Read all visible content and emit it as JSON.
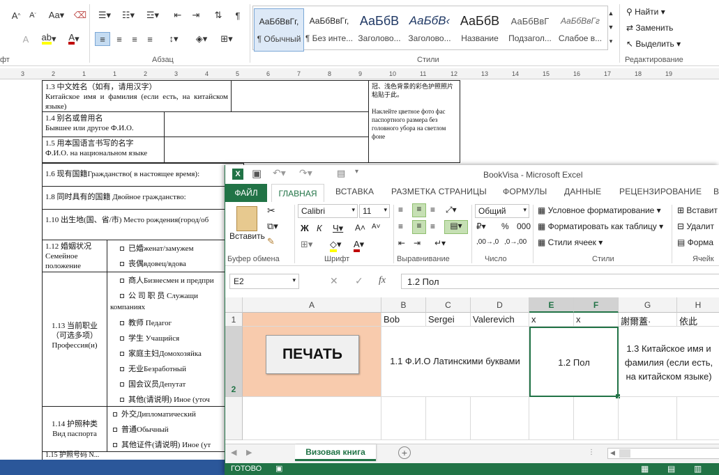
{
  "word": {
    "groups": {
      "font_partial": "фт",
      "paragraph": "Абзац",
      "styles": "Стили",
      "editing": "Редактирование"
    },
    "styles": [
      {
        "sample": "АаБбВвГг,",
        "name": "¶ Обычный"
      },
      {
        "sample": "АаБбВвГг,",
        "name": "¶ Без инте..."
      },
      {
        "sample": "АаБбВ",
        "name": "Заголово..."
      },
      {
        "sample": "АаБбВ‹",
        "name": "Заголово..."
      },
      {
        "sample": "АаБбВ",
        "name": "Название"
      },
      {
        "sample": "АаБбВвГ",
        "name": "Подзагол..."
      },
      {
        "sample": "АаБбВвГг",
        "name": "Слабое в..."
      }
    ],
    "editing": {
      "find": "Найти",
      "replace": "Заменить",
      "select": "Выделить"
    },
    "ruler": [
      "3",
      "2",
      "1",
      "1",
      "2",
      "3",
      "4",
      "5",
      "6",
      "7",
      "8",
      "9",
      "10",
      "11",
      "12",
      "13",
      "14",
      "15",
      "16",
      "17",
      "18",
      "19"
    ],
    "doc": {
      "r13": "1.3 中文姓名（如有，请用汉字）",
      "r13b": "Китайское имя и фамилия (если есть, на китайском языке)",
      "r14": "1.4 别名或曾用名",
      "r14b": "Бывшее или другое Ф.И.О.",
      "r15": "1.5 用本国语言书写的名字",
      "r15b": "Ф.И.О. на национальном языке",
      "photo_cn": "冠、浅色背景的彩色护照照片粘贴于此。",
      "photo_ru": "Наклейте цветное фото фас паспортного размера без головного убора на светлом фоне",
      "r16": "1.6 现有国籍Гражданство( в настоящее время):",
      "r18": "1.8 同时具有的国籍 Двойное гражданство:",
      "r110": "1.10 出生地(国、省/市) Место рождения(город/об",
      "r112": "1.12 婚姻状况 Семейное положение",
      "r112_opts": [
        "已婚женат/замужем",
        "丧偶вдовец/вдова"
      ],
      "r113": "1.13 当前职业（可选多项）Профессия(и)",
      "r113_opts": [
        "商人Бизнесмен и предпри",
        "公 司 职 员 Служащи",
        "компаниях",
        "教师 Педагог",
        "学生 Учащийся",
        "家庭主妇Домохозяйка",
        "无业Безработный",
        "国会议员Депутат",
        "其他(请说明) Иное (уточ"
      ],
      "r114": "1.14 护照种类 Вид паспорта",
      "r114_opts": [
        "外交Дипломатический",
        "普通Обычный",
        "其他证件(请说明) Иное (ут"
      ],
      "r115": "1.15 护照号码 N..."
    }
  },
  "excel": {
    "title": "BookVisa - Microsoft Excel",
    "tabs": [
      "ФАЙЛ",
      "ГЛАВНАЯ",
      "ВСТАВКА",
      "РАЗМЕТКА СТРАНИЦЫ",
      "ФОРМУЛЫ",
      "ДАННЫЕ",
      "РЕЦЕНЗИРОВАНИЕ",
      "В"
    ],
    "active_tab": "ГЛАВНАЯ",
    "ribbon": {
      "paste": "Вставить",
      "clipboard": "Буфер обмена",
      "font_name": "Calibri",
      "font_size": "11",
      "font_group": "Шрифт",
      "align_group": "Выравнивание",
      "number_format": "Общий",
      "number_group": "Число",
      "cond_format": "Условное форматирование",
      "format_table": "Форматировать как таблицу",
      "cell_styles": "Стили ячеек",
      "styles_group": "Стили",
      "insert": "Вставит",
      "delete": "Удалит",
      "format": "Форма",
      "cells_group": "Ячейк"
    },
    "name_box": "E2",
    "formula_value": "1.2 Пол",
    "columns": [
      "A",
      "B",
      "C",
      "D",
      "E",
      "F",
      "G",
      "H"
    ],
    "rows": [
      "1",
      "2"
    ],
    "row1": {
      "B": "Bob",
      "C": "Sergei",
      "D": "Valerevich",
      "E": "x",
      "F": "x",
      "G": "謝爾蓋·",
      "H": "依此"
    },
    "row2": {
      "B": "1.1 Ф.И.О Латинскими буквами",
      "E": "1.2 Пол",
      "G": "1.3 Китайское имя и фамилия (если есть, на китайском языке)"
    },
    "print_button": "ПЕЧАТЬ",
    "sheet_tab": "Визовая книга",
    "status": "ГОТОВО",
    "colors": {
      "excel_green": "#217346",
      "word_blue": "#2b579a",
      "a_fill": "#f8cbad"
    }
  }
}
